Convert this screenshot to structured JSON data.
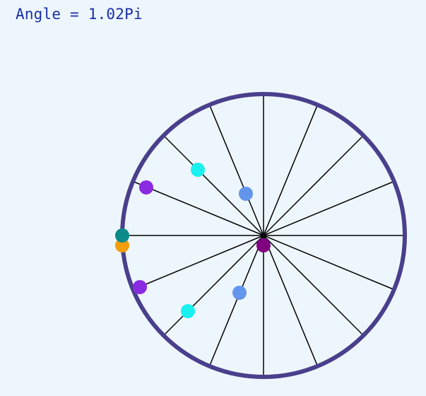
{
  "header": {
    "angle_text": "Angle = 1.02Pi"
  },
  "colors": {
    "background": "#eef6fd",
    "rim": "#4a3f8c",
    "spokes": "#000000",
    "label": "#1a2fa8"
  },
  "wheel": {
    "spoke_count": 16,
    "angle_pi": 1.02,
    "balls": [
      {
        "name": "ball-teal",
        "color": "#0a8a8a"
      },
      {
        "name": "ball-orange",
        "color": "#f59e0b"
      },
      {
        "name": "ball-purple-upper",
        "color": "#8a2be2"
      },
      {
        "name": "ball-purple-lower",
        "color": "#8a2be2"
      },
      {
        "name": "ball-cyan-upper",
        "color": "#19f0f0"
      },
      {
        "name": "ball-cyan-lower",
        "color": "#19f0f0"
      },
      {
        "name": "ball-blue-upper",
        "color": "#6495ed"
      },
      {
        "name": "ball-blue-lower",
        "color": "#6495ed"
      },
      {
        "name": "ball-center",
        "color": "#800080"
      }
    ]
  }
}
